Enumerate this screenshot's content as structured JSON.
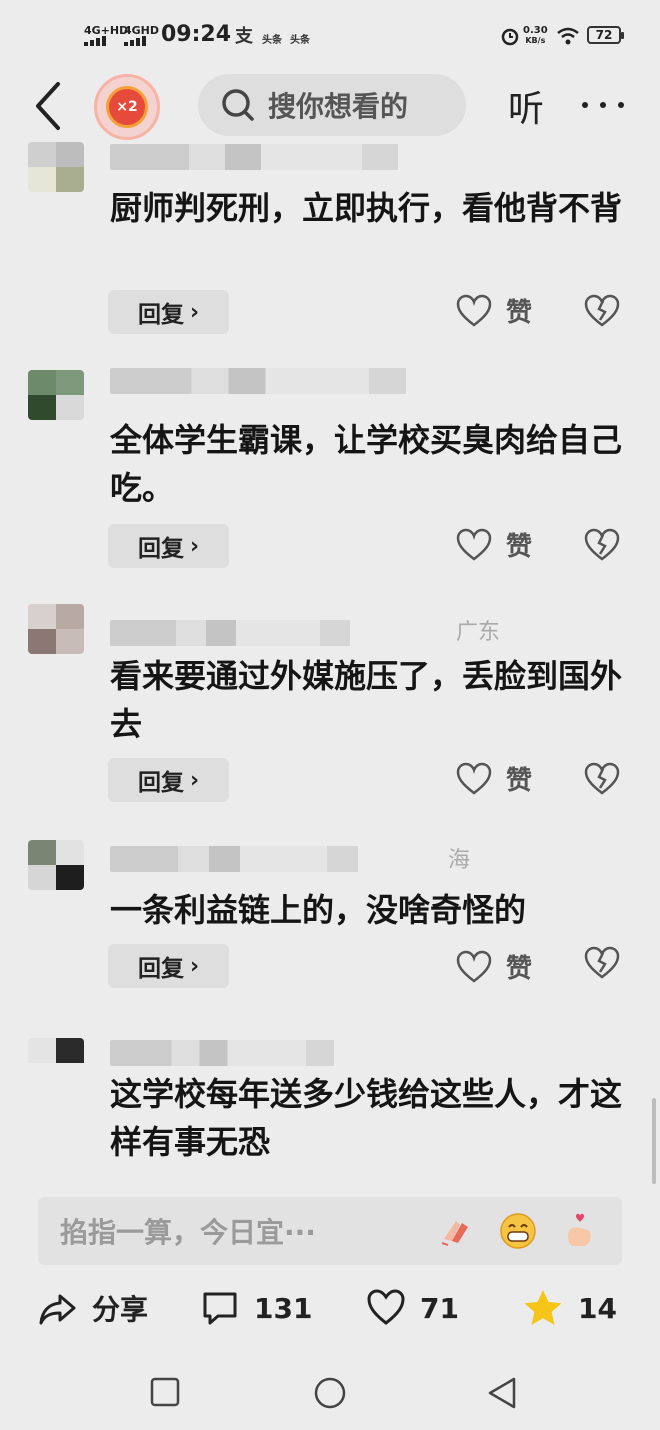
{
  "status_bar": {
    "network1": "4G+HD",
    "network2": "4GHD",
    "time": "09:24",
    "app_icon1": "支",
    "app_icon2": "头条",
    "app_icon3": "头条",
    "speed_value": "0.30",
    "speed_unit": "KB/s",
    "battery": "72"
  },
  "top_bar": {
    "badge_text": "×2",
    "search_placeholder": "搜你想看的",
    "listen_label": "听"
  },
  "comments": [
    {
      "name_suffix": "",
      "text": "厨师判死刑，立即执行，看他背不背",
      "reply_label": "回复",
      "like_label": "赞"
    },
    {
      "name_suffix": "",
      "text": "全体学生霸课，让学校买臭肉给自己吃。",
      "reply_label": "回复",
      "like_label": "赞"
    },
    {
      "name_suffix": "广东",
      "text": "看来要通过外媒施压了，丢脸到国外去",
      "reply_label": "回复",
      "like_label": "赞"
    },
    {
      "name_suffix": "海",
      "text": "一条利益链上的，没啥奇怪的",
      "reply_label": "回复",
      "like_label": "赞"
    },
    {
      "name_suffix": "",
      "text": "这学校每年送多少钱给这些人，才这样有事无恐",
      "reply_label": "",
      "like_label": ""
    }
  ],
  "input_bar": {
    "placeholder": "掐指一算，今日宜···"
  },
  "bottom_actions": {
    "share_label": "分享",
    "comment_count": "131",
    "like_count": "71",
    "favorite_count": "14"
  },
  "colors": {
    "background": "#ececec",
    "star": "#f5c518",
    "badge_red": "#e64a3b"
  }
}
